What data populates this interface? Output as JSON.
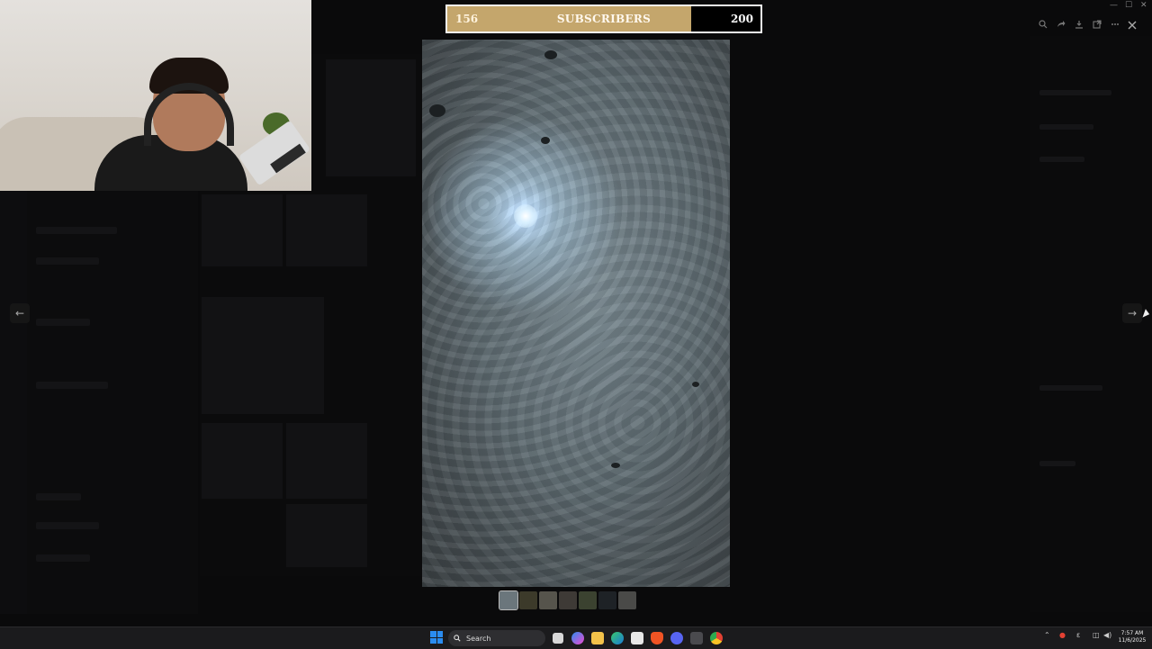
{
  "subscriber_goal": {
    "current": "156",
    "label": "SUBSCRIBERS",
    "goal": "200",
    "progress_fraction": 0.78,
    "fill_color": "#c4a66c"
  },
  "viewer": {
    "image_subject": "night sky with moon behind clouds",
    "toolbar_icons": [
      "zoom-icon",
      "forward-icon",
      "download-icon",
      "open-external-icon",
      "more-icon"
    ],
    "close_icon": "close-icon",
    "prev_arrow": "←",
    "next_arrow": "→",
    "thumbnail_count": 7,
    "active_thumbnail_index": 0
  },
  "window_controls": [
    "—",
    "☐",
    "✕"
  ],
  "taskbar": {
    "search_label": "Search",
    "apps": [
      "task-view-icon",
      "copilot-icon",
      "file-explorer-icon",
      "edge-icon",
      "store-icon",
      "brave-icon",
      "discord-icon",
      "app-icon",
      "chrome-icon"
    ],
    "clock_time": "7:57 AM",
    "clock_date": "11/6/2025",
    "accent_color": "#2a8cf0"
  }
}
